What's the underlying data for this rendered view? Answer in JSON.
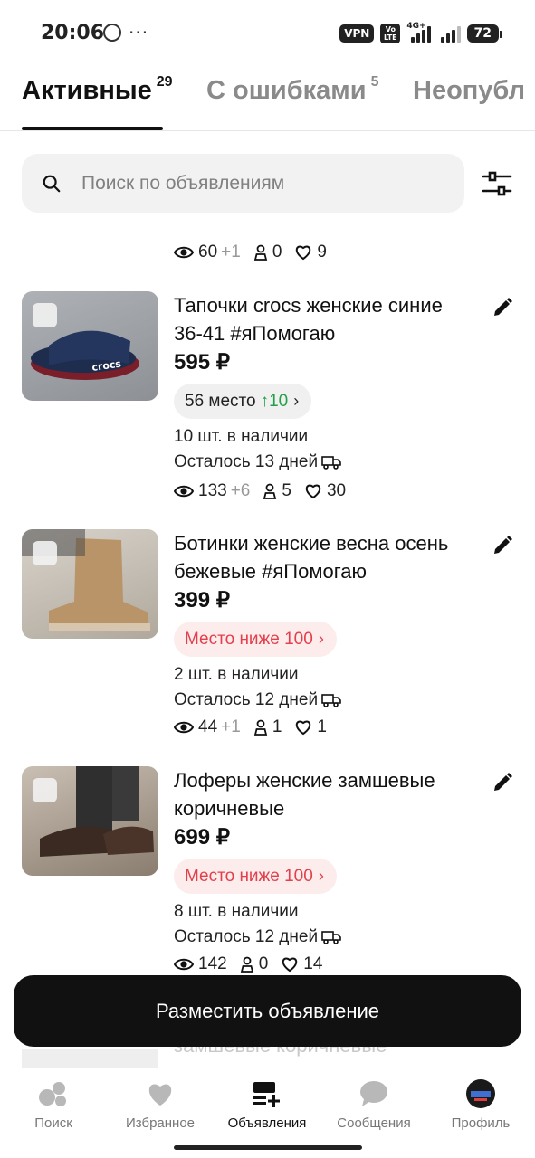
{
  "status": {
    "time": "20:06",
    "dots": "···",
    "vpn": "VPN",
    "volte_top": "Vo",
    "volte_bottom": "LTE",
    "network": "4G+",
    "battery": "72"
  },
  "tabs": [
    {
      "label": "Активные",
      "count": "29",
      "active": true
    },
    {
      "label": "С ошибками",
      "count": "5",
      "active": false
    },
    {
      "label": "Неопубл",
      "count": "",
      "active": false
    }
  ],
  "search": {
    "placeholder": "Поиск по объявлениям",
    "value": ""
  },
  "top_stats": {
    "views": "60",
    "views_delta": "+1",
    "contacts": "0",
    "likes": "9"
  },
  "listings": [
    {
      "title": "Тапочки crocs женские синие 36-41 #яПомогаю",
      "price": "595 ₽",
      "rank_text": "56 место",
      "rank_change": "↑10",
      "rank_style": "gray",
      "stock": "10 шт. в наличии",
      "days_left": "Осталось 13 дней",
      "views": "133",
      "views_delta": "+6",
      "contacts": "5",
      "likes": "30",
      "thumb_color": "#9a9ea4"
    },
    {
      "title": "Ботинки женские весна осень бежевые #яПомогаю",
      "price": "399 ₽",
      "rank_text": "Место ниже 100",
      "rank_change": "",
      "rank_style": "red",
      "stock": "2 шт. в наличии",
      "days_left": "Осталось 12 дней",
      "views": "44",
      "views_delta": "+1",
      "contacts": "1",
      "likes": "1",
      "thumb_color": "#bfb6a8"
    },
    {
      "title": "Лоферы женские замшевые коричневые",
      "price": "699 ₽",
      "rank_text": "Место ниже 100",
      "rank_change": "",
      "rank_style": "red",
      "stock": "8 шт. в наличии",
      "days_left": "Осталось 12 дней",
      "views": "142",
      "views_delta": "",
      "contacts": "0",
      "likes": "14",
      "thumb_color": "#5a4c42"
    }
  ],
  "fab_label": "Разместить объявление",
  "ghost_text": "замшевые коричневые",
  "nav": [
    {
      "label": "Поиск",
      "icon": "search-nav-icon",
      "active": false
    },
    {
      "label": "Избранное",
      "icon": "heart-icon",
      "active": false
    },
    {
      "label": "Объявления",
      "icon": "listings-icon",
      "active": true
    },
    {
      "label": "Сообщения",
      "icon": "chat-icon",
      "active": false
    },
    {
      "label": "Профиль",
      "icon": "avatar",
      "active": false
    }
  ],
  "colors": {
    "accent_red": "#e2404c",
    "accent_green": "#22a04a",
    "dark": "#111111"
  }
}
